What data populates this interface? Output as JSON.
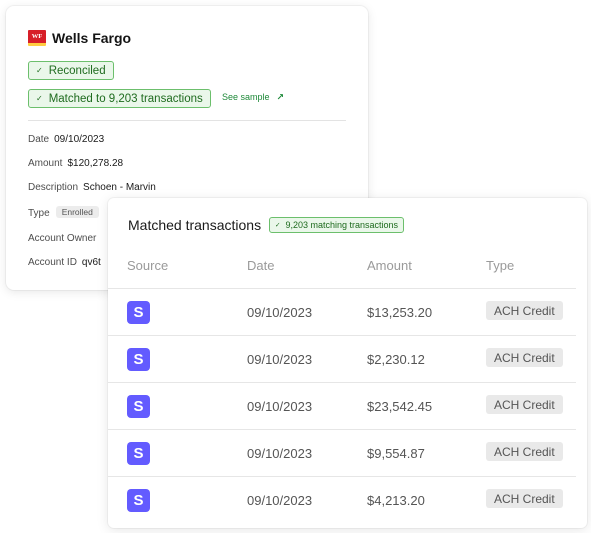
{
  "bank": {
    "logo_text": "WF",
    "name": "Wells Fargo",
    "status": "Reconciled",
    "matched_label": "Matched to 9,203 transactions",
    "see_sample": "See sample",
    "fields": {
      "date": {
        "label": "Date",
        "value": "09/10/2023"
      },
      "amount": {
        "label": "Amount",
        "value": "$120,278.28"
      },
      "description": {
        "label": "Description",
        "value": "Schoen - Marvin"
      },
      "type": {
        "label": "Type",
        "value": "Enrolled"
      },
      "owner": {
        "label": "Account Owner",
        "value": ""
      },
      "account_id": {
        "label": "Account ID",
        "value": "qv6t"
      }
    }
  },
  "matched": {
    "title": "Matched transactions",
    "badge": "9,203 matching transactions",
    "columns": [
      "Source",
      "Date",
      "Amount",
      "Type"
    ],
    "rows": [
      {
        "source": "S",
        "date": "09/10/2023",
        "amount": "$13,253.20",
        "type": "ACH Credit"
      },
      {
        "source": "S",
        "date": "09/10/2023",
        "amount": "$2,230.12",
        "type": "ACH Credit"
      },
      {
        "source": "S",
        "date": "09/10/2023",
        "amount": "$23,542.45",
        "type": "ACH Credit"
      },
      {
        "source": "S",
        "date": "09/10/2023",
        "amount": "$9,554.87",
        "type": "ACH Credit"
      },
      {
        "source": "S",
        "date": "09/10/2023",
        "amount": "$4,213.20",
        "type": "ACH Credit"
      }
    ]
  },
  "colors": {
    "success_text": "#1e6b1e",
    "success_bg": "#eaf7ea",
    "success_border": "#6cbf6c",
    "link_green": "#1f8a3a",
    "brand_red": "#d71e28",
    "brand_yellow": "#ffcd41",
    "stripe_purple": "#635bff"
  },
  "icons": {
    "check": "check-icon",
    "arrow": "arrow-up-right-icon",
    "source": "stripe-logo-icon"
  }
}
